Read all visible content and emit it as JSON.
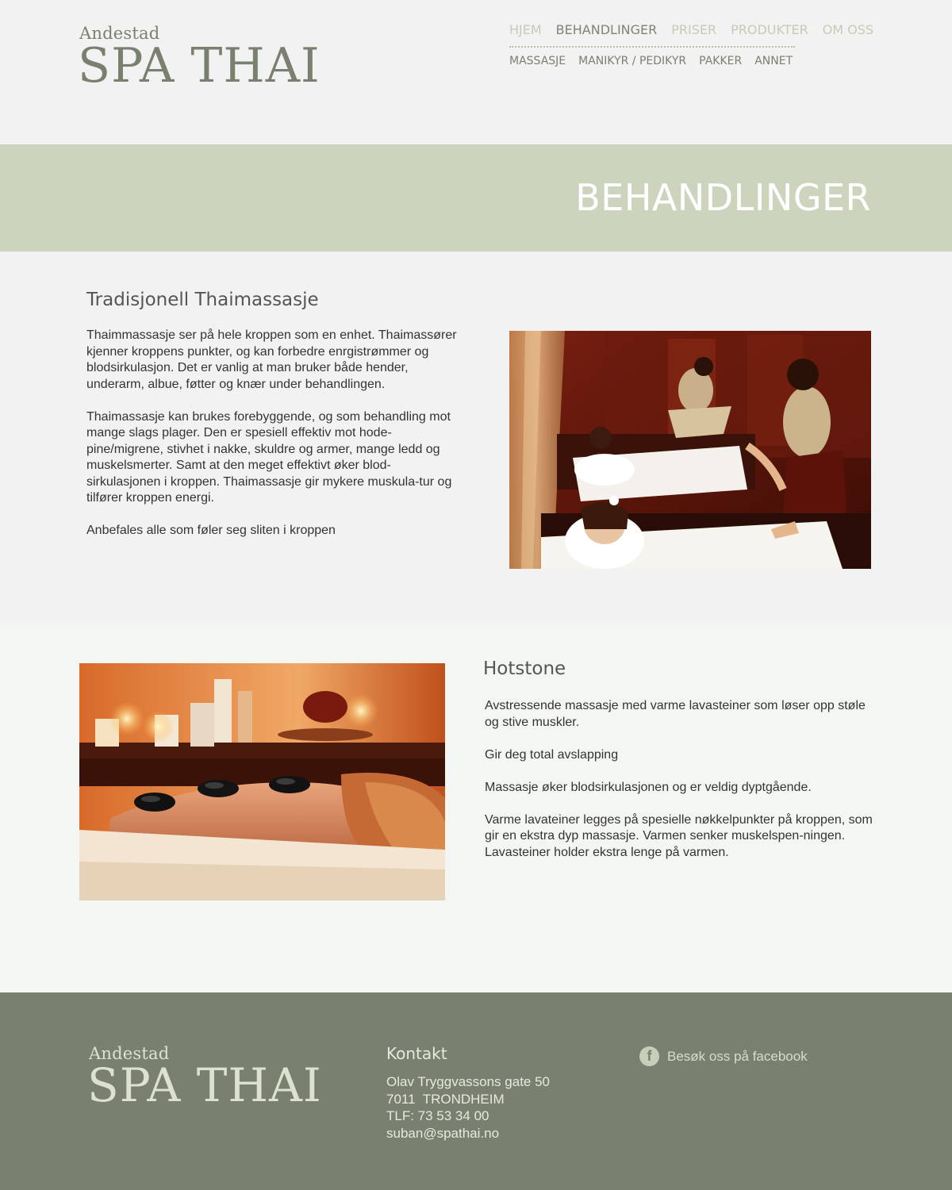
{
  "header": {
    "logo_small": "Andestad",
    "logo_big": "SPA THAI",
    "nav": [
      "HJEM",
      "BEHANDLINGER",
      "PRISER",
      "PRODUKTER",
      "OM OSS"
    ],
    "subnav": [
      "MASSASJE",
      "MANIKYR / PEDIKYR",
      "PAKKER",
      "ANNET"
    ]
  },
  "banner": {
    "title": "BEHANDLINGER"
  },
  "thai": {
    "title": "Tradisjonell Thaimassasje",
    "paragraphs": [
      "Thaimmassasje ser på hele kroppen som en enhet. Thaimassører kjenner kroppens punkter, og kan forbedre enrgistrømmer og blodsirkulasjon.  Det er vanlig at man bruker både hender, underarm, albue, føtter og knær under behandlingen.",
      "Thaimassasje kan brukes forebyggende, og som behandling mot mange slags plager.  Den er spesiell effektiv mot hode-pine/migrene, stivhet i nakke, skuldre og armer, mange ledd og muskelsmerter.  Samt at den meget effektivt øker blod-sirkulasjonen i kroppen.  Thaimassasje gir mykere muskula-tur og tilfører kroppen energi.",
      "Anbefales alle som føler seg sliten i kroppen"
    ]
  },
  "hotstone": {
    "title": "Hotstone",
    "paragraphs": [
      "Avstressende massasje med varme lavasteiner som løser opp støle og stive muskler.",
      "Gir deg total avslapping",
      "Massasje øker blodsirkulasjonen og er veldig dyptgående.",
      "Varme lavateiner legges på spesielle nøkkelpunkter på kroppen, som gir en ekstra dyp massasje.  Varmen senker muskelspen-ningen.  Lavasteiner holder ekstra lenge på varmen."
    ]
  },
  "footer": {
    "logo_small": "Andestad",
    "logo_big": "SPA THAI",
    "contact_title": "Kontakt",
    "contact_lines": [
      "Olav Tryggvassons gate 50",
      "7011  TRONDHEIM",
      "TLF: 73 53 34 00",
      "suban@spathai.no"
    ],
    "facebook_label": "Besøk oss på facebook",
    "facebook_icon": "f"
  },
  "colors": {
    "banner": "#cdd4bd",
    "footer": "#7a806f",
    "nav_active": "#7e8474",
    "nav_inactive": "#c5cbb5"
  }
}
